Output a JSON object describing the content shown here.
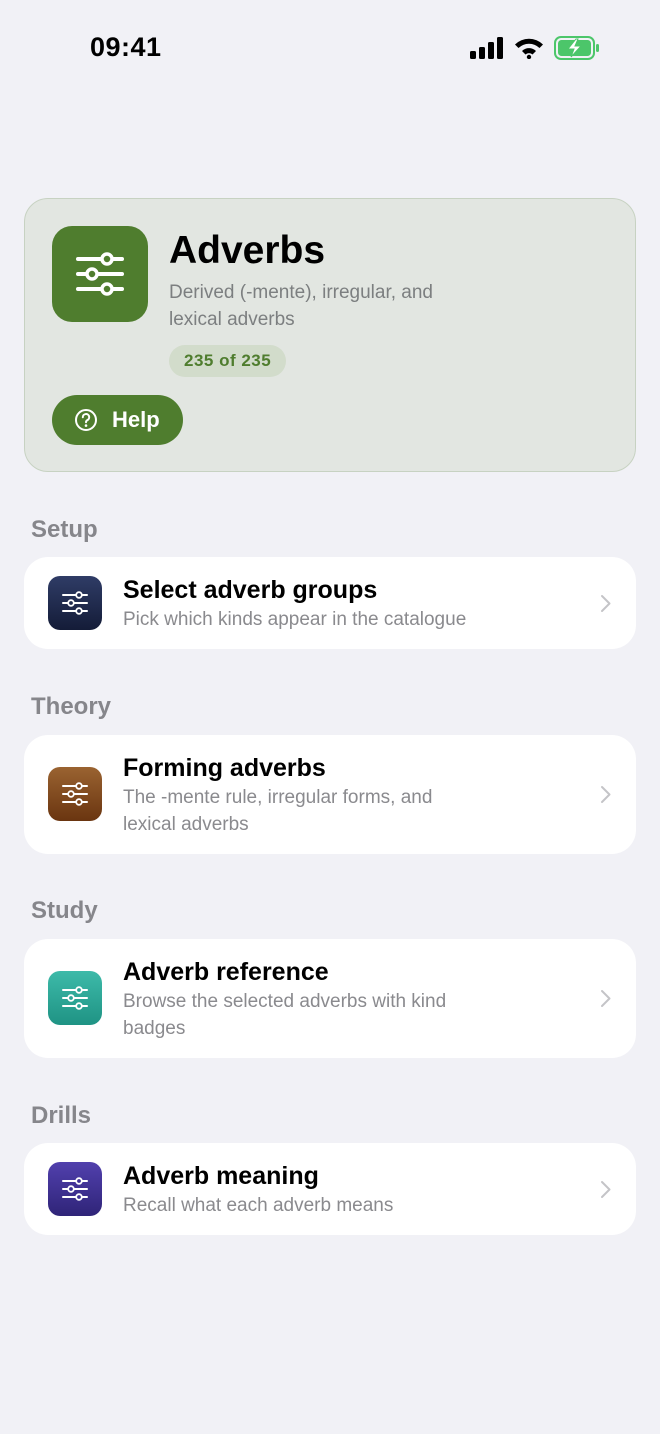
{
  "status_bar": {
    "time": "09:41"
  },
  "hero": {
    "title": "Adverbs",
    "subtitle": "Derived (-mente), irregular, and lexical adverbs",
    "badge": "235 of 235",
    "help_label": "Help",
    "icon": "sliders-icon",
    "accent_color": "#4f7d2e"
  },
  "sections": {
    "setup": {
      "header": "Setup",
      "card": {
        "title": "Select adverb groups",
        "subtitle": "Pick which kinds appear in the catalogue",
        "icon": "sliders-icon",
        "color": "#1f2a4d"
      }
    },
    "theory": {
      "header": "Theory",
      "card": {
        "title": "Forming adverbs",
        "subtitle": "The -mente rule, irregular forms, and lexical adverbs",
        "icon": "sliders-icon",
        "color": "#7a4318"
      }
    },
    "study": {
      "header": "Study",
      "card": {
        "title": "Adverb reference",
        "subtitle": "Browse the selected adverbs with kind badges",
        "icon": "sliders-icon",
        "color": "#2aa396"
      }
    },
    "drills": {
      "header": "Drills",
      "card": {
        "title": "Adverb meaning",
        "subtitle": "Recall what each adverb means",
        "icon": "sliders-icon",
        "color": "#3d2f92"
      }
    }
  }
}
